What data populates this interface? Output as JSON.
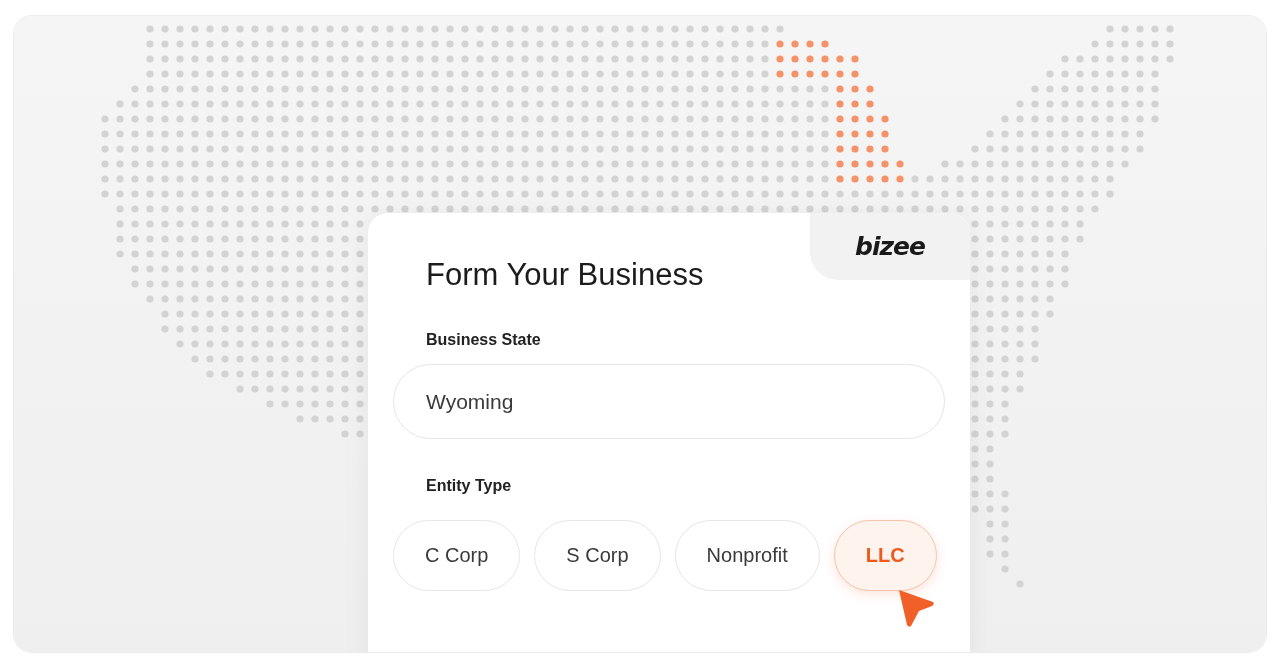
{
  "logo": "bizee",
  "form": {
    "title": "Form Your Business",
    "business_state": {
      "label": "Business State",
      "value": "Wyoming"
    },
    "entity_type": {
      "label": "Entity Type",
      "options": [
        {
          "label": "C Corp",
          "selected": false
        },
        {
          "label": "S Corp",
          "selected": false
        },
        {
          "label": "Nonprofit",
          "selected": false
        },
        {
          "label": "LLC",
          "selected": true
        }
      ]
    }
  }
}
